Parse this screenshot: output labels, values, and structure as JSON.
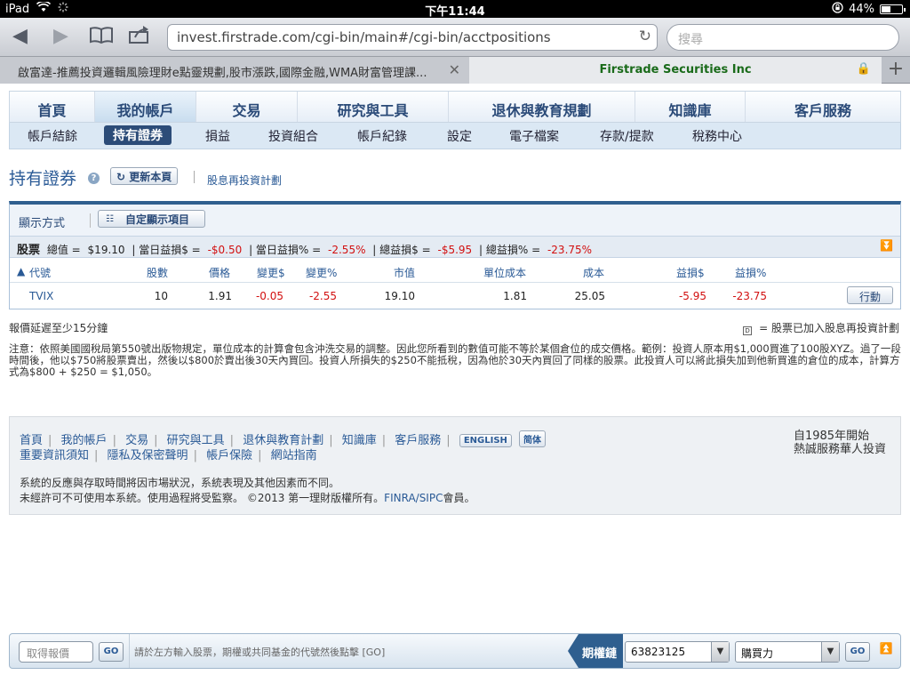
{
  "status_bar": {
    "device": "iPad",
    "time": "下午11:44",
    "battery": "44%",
    "battery_level": 0.44
  },
  "browser": {
    "url": "invest.firstrade.com/cgi-bin/main#/cgi-bin/acctpositions",
    "search_placeholder": "搜尋",
    "tabs": [
      {
        "title": "啟富達-推薦投資邏輯風險理財e點靈規劃,股市漲跌,國際金融,WMA財富管理課..."
      },
      {
        "title": "Firstrade Securities Inc"
      }
    ]
  },
  "main_nav": [
    {
      "label": "首頁"
    },
    {
      "label": "我的帳戶"
    },
    {
      "label": "交易"
    },
    {
      "label": "研究與工具"
    },
    {
      "label": "退休與教育規劃"
    },
    {
      "label": "知識庫"
    },
    {
      "label": "客戶服務"
    }
  ],
  "sub_nav": [
    {
      "label": "帳戶結餘"
    },
    {
      "label": "持有證券"
    },
    {
      "label": "損益"
    },
    {
      "label": "投資組合"
    },
    {
      "label": "帳戶紀錄"
    },
    {
      "label": "設定"
    },
    {
      "label": "電子檔案"
    },
    {
      "label": "存款/提款"
    },
    {
      "label": "稅務中心"
    }
  ],
  "page": {
    "title": "持有證券",
    "refresh_label": "更新本頁",
    "drip_link": "股息再投資計劃"
  },
  "display": {
    "label": "顯示方式",
    "custom_label": "自定顯示項目"
  },
  "summary": {
    "section": "股票",
    "total_value_label": "總值 =",
    "total_value": "$19.10",
    "day_gain_label": "當日益損$ =",
    "day_gain": "-$0.50",
    "day_gain_pct_label": "當日益損% =",
    "day_gain_pct": "-2.55%",
    "total_gain_label": "總益損$ =",
    "total_gain": "-$5.95",
    "total_gain_pct_label": "總益損% =",
    "total_gain_pct": "-23.75%"
  },
  "table": {
    "headers": [
      "代號",
      "股數",
      "價格",
      "變更$",
      "變更%",
      "市值",
      "單位成本",
      "成本",
      "益損$",
      "益損%"
    ],
    "rows": [
      {
        "symbol": "TVIX",
        "qty": "10",
        "price": "1.91",
        "chg": "-0.05",
        "chg_pct": "-2.55",
        "mkt_value": "19.10",
        "unit_cost": "1.81",
        "cost": "25.05",
        "gain": "-5.95",
        "gain_pct": "-23.75",
        "action": "行動"
      }
    ]
  },
  "notes": {
    "delay": "報價延遲至少15分鐘",
    "drip_legend": "= 股票已加入股息再投資計劃",
    "disclaimer": "注意：依照美國國稅局第550號出版物規定，單位成本的計算會包含沖洗交易的調整。因此您所看到的數值可能不等於某個倉位的成交價格。範例：投資人原本用$1,000買進了100股XYZ。過了一段時間後，他以$750將股票賣出，然後以$800於賣出後30天內買回。投資人所損失的$250不能抵稅，因為他於30天內買回了同樣的股票。此投資人可以將此損失加到他新買進的倉位的成本，計算方式為$800 + $250 = $1,050。"
  },
  "footer": {
    "links_row1": [
      "首頁",
      "我的帳戶",
      "交易",
      "研究與工具",
      "退休與教育計劃",
      "知識庫",
      "客戶服務"
    ],
    "lang_english": "ENGLISH",
    "lang_simplified": "简体",
    "links_row2": [
      "重要資訊須知",
      "隱私及保密聲明",
      "帳戶保險",
      "網站指南"
    ],
    "slogan_line1": "自1985年開始",
    "slogan_line2": "熱誠服務華人投資",
    "system_note": "系統的反應與存取時間將因市場狀況，系統表現及其他因素而不同。",
    "copyright": "未經許可不可使用本系統。使用過程將受監察。 ©2013 第一理財版權所有。",
    "finra": "FINRA/SIPC",
    "member": "會員。"
  },
  "quote_bar": {
    "quote_placeholder": "取得報價",
    "go": "GO",
    "hint": "請於左方輸入股票，期權或共同基金的代號然後點擊 [GO]",
    "futures_label": "期權鏈",
    "account_value": "63823125",
    "buying_power_value": "購買力"
  }
}
